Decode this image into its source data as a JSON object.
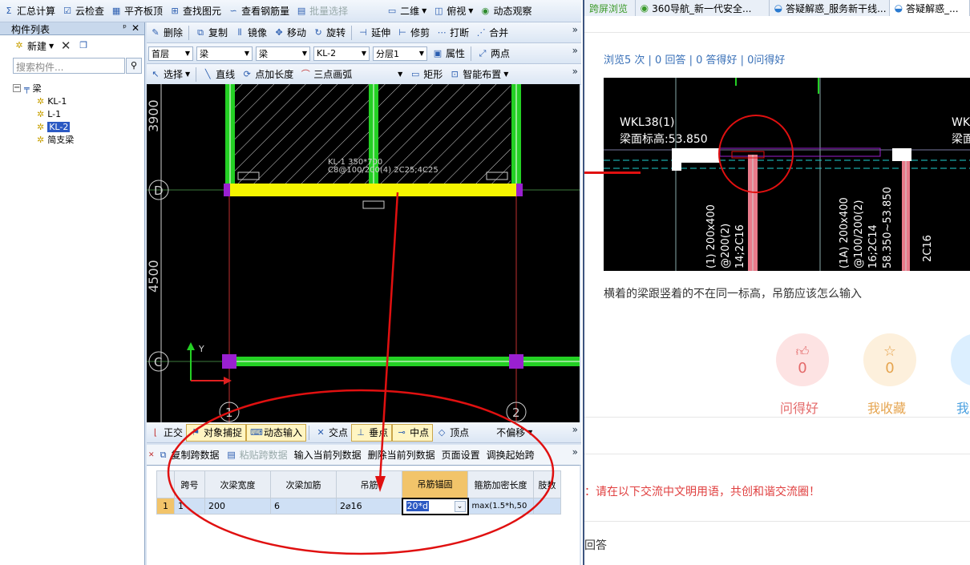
{
  "toolbar1": {
    "items": [
      "汇总计算",
      "云检查",
      "平齐板顶",
      "查找图元",
      "查看钢筋量",
      "批量选择"
    ],
    "view2d": "二维",
    "view": "俯视",
    "dynamic": "动态观察"
  },
  "toolbar2": {
    "items": [
      "删除",
      "复制",
      "镜像",
      "移动",
      "旋转",
      "延伸",
      "修剪",
      "打断",
      "合并"
    ]
  },
  "toolbar3": {
    "floor": "首层",
    "cat1": "梁",
    "cat2": "梁",
    "name": "KL-2",
    "layer": "分层1",
    "props": "属性",
    "twopoint": "两点"
  },
  "toolbar4": {
    "select": "选择",
    "line": "直线",
    "pointlen": "点加长度",
    "arc": "三点画弧",
    "rect": "矩形",
    "smart": "智能布置"
  },
  "panel": {
    "title": "构件列表",
    "new": "新建",
    "search_placeholder": "搜索构件...",
    "root": "梁",
    "items": [
      "KL-1",
      "L-1",
      "KL-2",
      "简支梁"
    ]
  },
  "canvas": {
    "dim1": "3900",
    "dim2": "4500",
    "axisD": "D",
    "axisC": "C",
    "axis1": "1",
    "axis2": "2",
    "beam_label": "KL-1 350*700",
    "beam_label2": "C8@100/200(4) 2C25;4C25",
    "yaxis": "Y"
  },
  "snapbar": {
    "items": [
      "正交",
      "对象捕捉",
      "动态输入",
      "交点",
      "垂点",
      "中点",
      "顶点"
    ],
    "offset": "不偏移"
  },
  "gridbar": {
    "items": [
      "复制跨数据",
      "粘贴跨数据",
      "输入当前列数据",
      "删除当前列数据",
      "页面设置",
      "调换起始跨"
    ]
  },
  "grid": {
    "headers": [
      "跨号",
      "次梁宽度",
      "次梁加筋",
      "吊筋",
      "吊筋锚固",
      "箍筋加密长度",
      "肢数"
    ],
    "row": {
      "num": "1",
      "span": "1",
      "width": "200",
      "add": "6",
      "hang": "2⌀16",
      "anchor": "20*d",
      "dense": "max(1.5*h,50"
    }
  },
  "browser": {
    "tabs": [
      "跨屏浏览",
      "360导航_新一代安全...",
      "答疑解惑_服务新干线...",
      "答疑解惑_..."
    ],
    "stats": "浏览5 次 | 0 回答 | 0 答得好 | 0问得好",
    "question": "横着的梁跟竖着的不在同一标高，吊筋应该怎么输入",
    "img": {
      "label1": "WKL38(1)",
      "label2": "梁面标高:53.850",
      "label3": "WK",
      "label4": "梁面",
      "v1": "(1) 200x400",
      "v2": "@200(2)",
      "v3": "14;2C16",
      "v4": "(1A) 200x400",
      "v5": "@100/200(2)",
      "v6": "16;2C14",
      "v7": "58.350~53.850",
      "v8": "2C16"
    },
    "likes": {
      "label": "问得好",
      "count": "0"
    },
    "fav": {
      "label": "我收藏",
      "count": "0"
    },
    "third": {
      "label": "我"
    },
    "notice": "：请在以下交流中文明用语，共创和谐交流圈！",
    "answer": "未回答"
  }
}
